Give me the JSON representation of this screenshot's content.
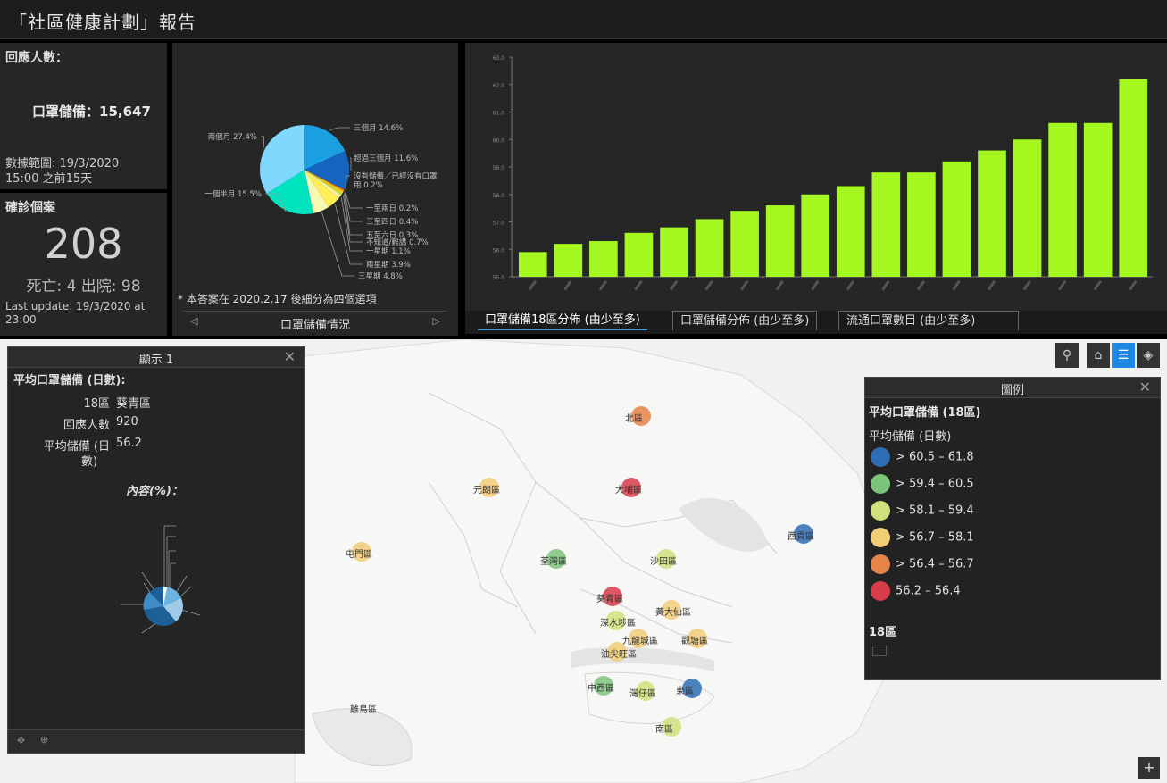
{
  "header": {
    "title": "「社區健康計劃」報告"
  },
  "responses": {
    "label": "回應人數：",
    "metric": "口罩儲備：",
    "value": "15,647",
    "range_line1": "數據範圍: 19/3/2020",
    "range_line2": "15:00 之前15天"
  },
  "cases": {
    "label": "確診個案",
    "value": "208",
    "sub": "死亡: 4 出院: 98",
    "update_line1": "Last update: 19/3/2020 at",
    "update_line2": "23:00"
  },
  "pie_panel": {
    "note": "* 本答案在 2020.2.17 後細分為四個選項",
    "nav_label": "口罩儲備情況",
    "chart_data": {
      "type": "pie",
      "slices": [
        {
          "label": "三個月 14.6%",
          "value": 14.6,
          "color": "#1aa0e0"
        },
        {
          "label": "超過三個月 11.6%",
          "value": 11.6,
          "color": "#1565c0"
        },
        {
          "label": "沒有儲備／已經沒有口罩用 0.2%",
          "value": 0.2,
          "color": "#ff5722"
        },
        {
          "label": "一至兩日 0.2%",
          "value": 0.2,
          "color": "#ff9800"
        },
        {
          "label": "三至四日 0.4%",
          "value": 0.4,
          "color": "#ffc107"
        },
        {
          "label": "五至六日 0.3%",
          "value": 0.3,
          "color": "#ffeb3b"
        },
        {
          "label": "不知道/難講 0.7%",
          "value": 0.7,
          "color": "#cddc39"
        },
        {
          "label": "一星期 1.1%",
          "value": 1.1,
          "color": "#fff59d"
        },
        {
          "label": "兩星期 3.9%",
          "value": 3.9,
          "color": "#ffee58"
        },
        {
          "label": "三星期 4.8%",
          "value": 4.8,
          "color": "#f8f8b0"
        },
        {
          "label": "一個半月 15.5%",
          "value": 15.5,
          "color": "#00e5c0"
        },
        {
          "label": "兩個月 27.4%",
          "value": 27.4,
          "color": "#80d8ff"
        }
      ]
    }
  },
  "bar_panel": {
    "chart_data": {
      "type": "bar",
      "values": [
        55.9,
        56.2,
        56.3,
        56.6,
        56.8,
        57.1,
        57.4,
        57.6,
        58.0,
        58.3,
        58.8,
        58.8,
        59.2,
        59.6,
        60.0,
        60.6,
        60.6,
        62.2
      ],
      "ylim": [
        55,
        63
      ],
      "yticks": [
        "55.0",
        "56.0",
        "57.0",
        "58.0",
        "59.0",
        "60.0",
        "61.0",
        "62.0",
        "63.0"
      ],
      "bar_color": "#a4f81f"
    }
  },
  "tabs": [
    {
      "label": "口罩儲備18區分佈 (由少至多)"
    },
    {
      "label": "口罩儲備分佈 (由少至多)"
    },
    {
      "label": "流通口罩數目 (由少至多)"
    }
  ],
  "popup": {
    "title": "顯示 1",
    "heading": "平均口罩儲備 (日數):",
    "fields": [
      {
        "key": "18區",
        "value": "葵青區"
      },
      {
        "key": "回應人數",
        "value": "920"
      },
      {
        "key": "平均儲備 (日",
        "value": "56.2"
      }
    ],
    "field_wrap": "數)",
    "content_title": "內容(%)："
  },
  "legend": {
    "title": "圖例",
    "layer": "平均口罩儲備 (18區)",
    "subtitle": "平均儲備 (日數)",
    "items": [
      {
        "label": "> 60.5 – 61.8",
        "color": "#2e6db4"
      },
      {
        "label": "> 59.4 – 60.5",
        "color": "#7cc47a"
      },
      {
        "label": "> 58.1 – 59.4",
        "color": "#cfe07c"
      },
      {
        "label": "> 56.7 – 58.1",
        "color": "#f1cd76"
      },
      {
        "label": "> 56.4 – 56.7",
        "color": "#e8834a"
      },
      {
        "label": "56.2 – 56.4",
        "color": "#d83c4a"
      }
    ],
    "section2": "18區"
  },
  "map": {
    "districts": [
      {
        "name": "北區",
        "color": "#e8834a"
      },
      {
        "name": "大埔區",
        "color": "#d83c4a"
      },
      {
        "name": "元朗區",
        "color": "#f1cd76"
      },
      {
        "name": "西貢區",
        "color": "#2e6db4"
      },
      {
        "name": "屯門區",
        "color": "#f1cd76"
      },
      {
        "name": "荃灣區",
        "color": "#7cc47a"
      },
      {
        "name": "沙田區",
        "color": "#cfe07c"
      },
      {
        "name": "葵青區",
        "color": "#d83c4a"
      },
      {
        "name": "黃大仙區",
        "color": "#f1cd76"
      },
      {
        "name": "深水埗區",
        "color": "#cfe07c"
      },
      {
        "name": "九龍城區",
        "color": "#f1cd76"
      },
      {
        "name": "觀塘區",
        "color": "#f1cd76"
      },
      {
        "name": "油尖旺區",
        "color": "#f1cd76"
      },
      {
        "name": "中西區",
        "color": "#7cc47a"
      },
      {
        "name": "灣仔區",
        "color": "#cfe07c"
      },
      {
        "name": "東區",
        "color": "#2e6db4"
      },
      {
        "name": "南區",
        "color": "#cfe07c"
      },
      {
        "name": "離島區",
        "color": "#f1cd76"
      }
    ]
  }
}
